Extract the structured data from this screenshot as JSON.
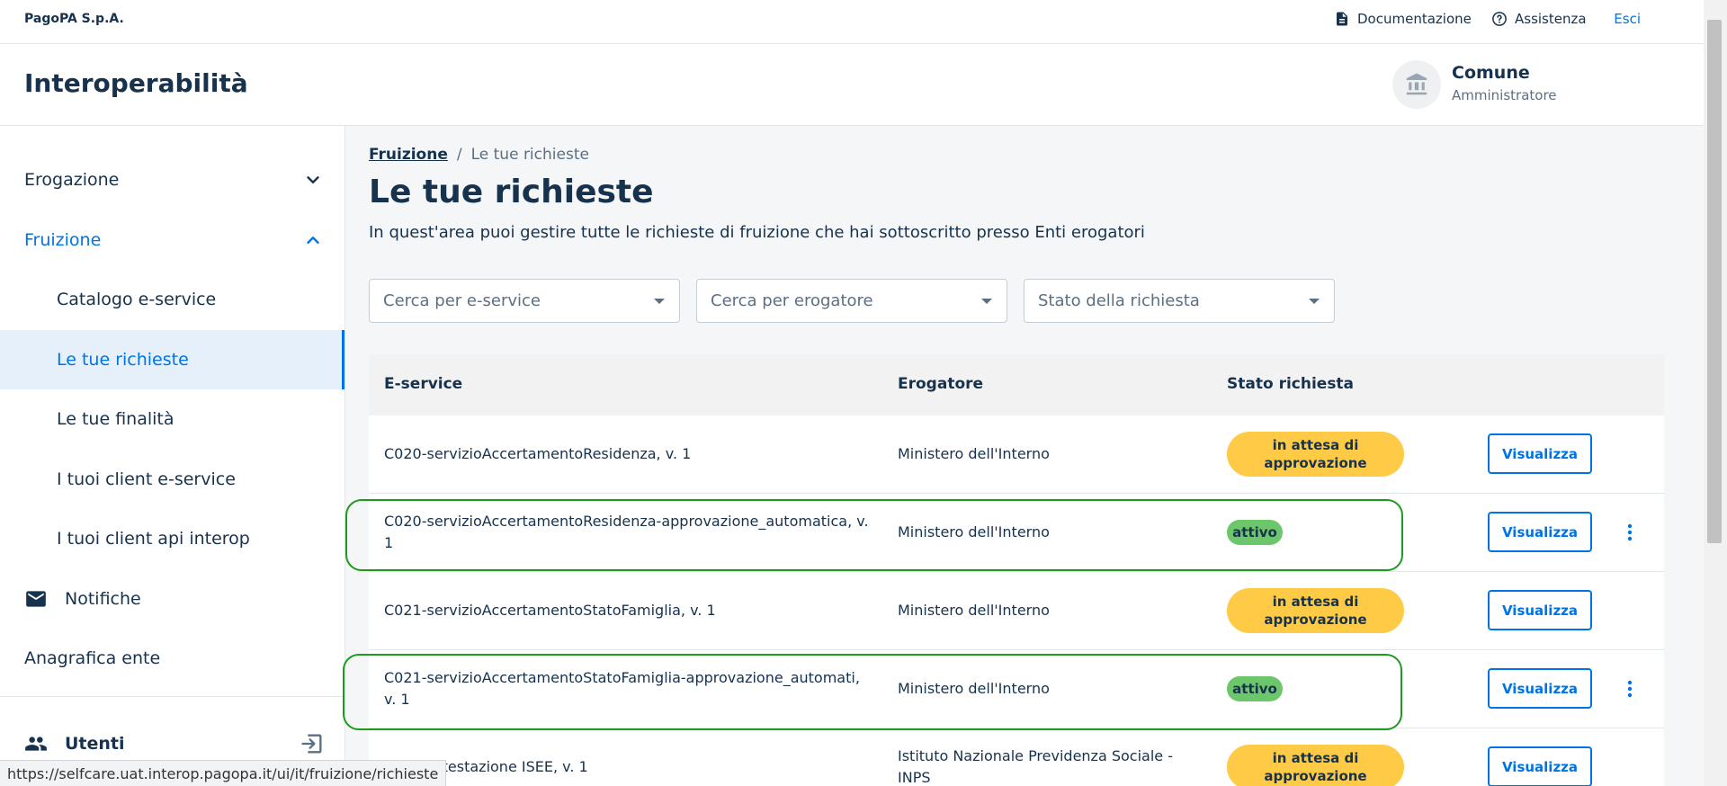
{
  "topbar": {
    "brand": "PagoPA S.p.A.",
    "docs_label": "Documentazione",
    "help_label": "Assistenza",
    "logout_label": "Esci"
  },
  "header": {
    "app_title": "Interoperabilità",
    "party_name": "Comune",
    "party_role": "Amministratore"
  },
  "sidebar": {
    "items": [
      {
        "label": "Erogazione"
      },
      {
        "label": "Fruizione"
      },
      {
        "label": "Catalogo e-service"
      },
      {
        "label": "Le tue richieste"
      },
      {
        "label": "Le tue finalità"
      },
      {
        "label": "I tuoi client e-service"
      },
      {
        "label": "I tuoi client api interop"
      },
      {
        "label": "Notifiche"
      },
      {
        "label": "Anagrafica ente"
      }
    ],
    "users_label": "Utenti"
  },
  "main": {
    "breadcrumb": {
      "parent": "Fruizione",
      "separator": "/",
      "current": "Le tue richieste"
    },
    "title": "Le tue richieste",
    "subtitle": "In quest'area puoi gestire tutte le richieste di fruizione che hai sottoscritto presso Enti erogatori",
    "filters": [
      {
        "placeholder": "Cerca per e-service"
      },
      {
        "placeholder": "Cerca per erogatore"
      },
      {
        "placeholder": "Stato della richiesta"
      }
    ],
    "table": {
      "headers": [
        "E-service",
        "Erogatore",
        "Stato richiesta"
      ],
      "rows": [
        {
          "eservice": "C020-servizioAccertamentoResidenza, v. 1",
          "erogatore": "Ministero dell'Interno",
          "stato": "in attesa di approvazione",
          "action": "Visualizza"
        },
        {
          "eservice": "C020-servizioAccertamentoResidenza-approvazione_automatica, v. 1",
          "erogatore": "Ministero dell'Interno",
          "stato": "attivo",
          "action": "Visualizza"
        },
        {
          "eservice": "C021-servizioAccertamentoStatoFamiglia, v. 1",
          "erogatore": "Ministero dell'Interno",
          "stato": "in attesa di approvazione",
          "action": "Visualizza"
        },
        {
          "eservice": "C021-servizioAccertamentoStatoFamiglia-approvazione_automati, v. 1",
          "erogatore": "Ministero dell'Interno",
          "stato": "attivo",
          "action": "Visualizza"
        },
        {
          "eservice": "zione Attestazione ISEE, v. 1",
          "erogatore": "Istituto Nazionale Previdenza Sociale - INPS",
          "stato": "in attesa di approvazione",
          "action": "Visualizza"
        }
      ]
    }
  },
  "status_url": "https://selfcare.uat.interop.pagopa.it/ui/it/fruizione/richieste",
  "colors": {
    "accent": "#0073E6",
    "text": "#17324D",
    "badge_pending": "#FFCB46",
    "badge_active": "#6CC66A",
    "highlight": "#1E9B1E"
  }
}
